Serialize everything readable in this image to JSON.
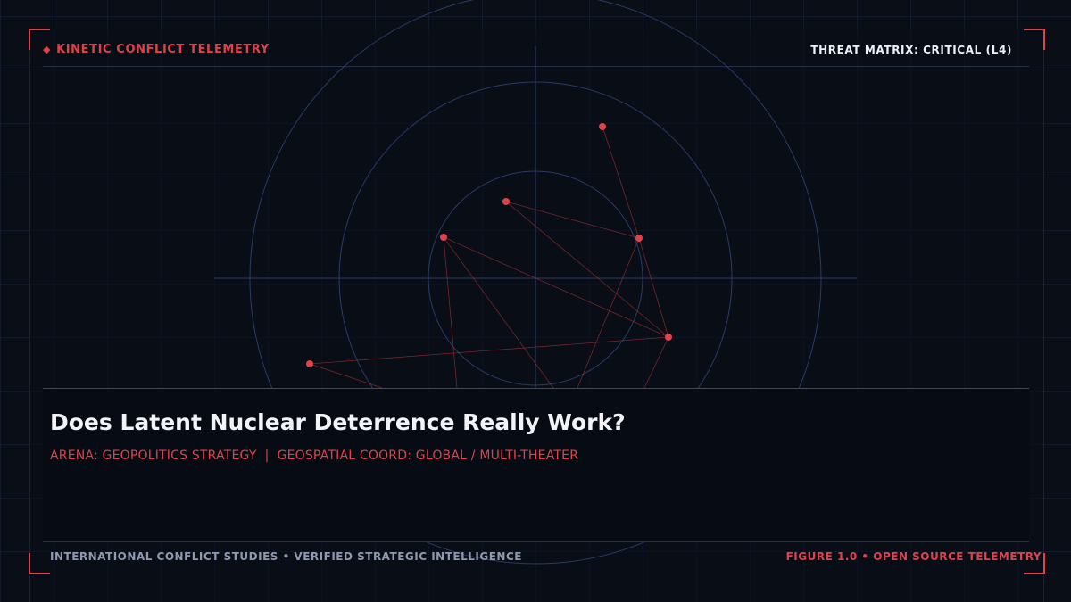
{
  "header": {
    "left_icon": "diamond-icon",
    "left_label": "KINETIC CONFLICT TELEMETRY",
    "right_label": "THREAT MATRIX: CRITICAL (L4)"
  },
  "title": "Does Latent Nuclear Deterrence Really Work?",
  "subtitle": {
    "arena": "ARENA: GEOPOLITICS STRATEGY",
    "separator": "|",
    "coord": "GEOSPATIAL COORD: GLOBAL / MULTI-THEATER"
  },
  "footer": {
    "left": "INTERNATIONAL CONFLICT STUDIES • VERIFIED STRATEGIC INTELLIGENCE",
    "right": "FIGURE 1.0 • OPEN SOURCE TELEMETRY"
  },
  "colors": {
    "accent": "#e0424a",
    "background": "#0a0e17",
    "grid": "#283a5c",
    "text": "#f2f4f8"
  }
}
